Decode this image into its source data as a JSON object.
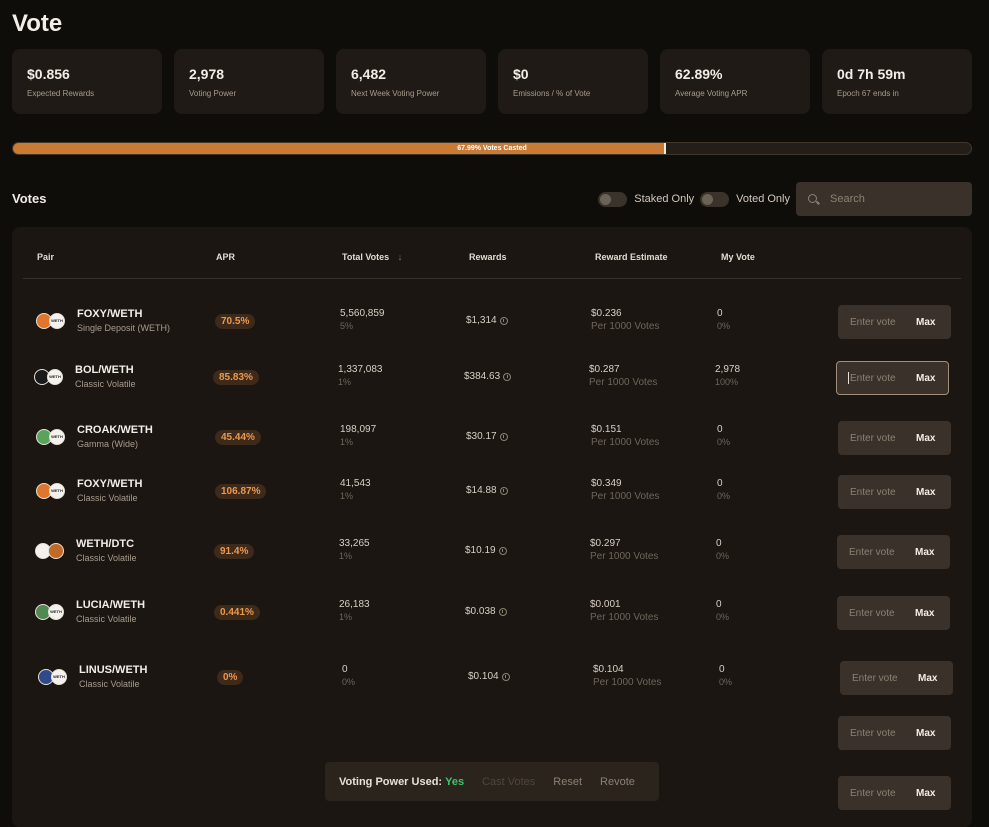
{
  "page": {
    "title": "Vote"
  },
  "stats": [
    {
      "value": "$0.856",
      "label": "Expected Rewards"
    },
    {
      "value": "2,978",
      "label": "Voting Power"
    },
    {
      "value": "6,482",
      "label": "Next Week Voting Power"
    },
    {
      "value": "$0",
      "label": "Emissions / % of Vote"
    },
    {
      "value": "62.89%",
      "label": "Average Voting APR"
    },
    {
      "value": "0d 7h 59m",
      "label": "Epoch 67 ends in"
    }
  ],
  "progress": {
    "label": "67.99% Votes Casted",
    "percent": 67.99
  },
  "votes": {
    "title": "Votes",
    "staked_only_label": "Staked Only",
    "voted_only_label": "Voted Only",
    "search_placeholder": "Search"
  },
  "table": {
    "headers": {
      "pair": "Pair",
      "apr": "APR",
      "total_votes": "Total Votes",
      "rewards": "Rewards",
      "reward_estimate": "Reward Estimate",
      "my_vote": "My Vote"
    },
    "sort_arrow": "↓",
    "input_placeholder": "Enter vote",
    "max_label": "Max",
    "rows": [
      {
        "pair": "FOXY/WETH",
        "type": "Single Deposit (WETH)",
        "apr": "70.5%",
        "total_votes": "5,560,859",
        "total_pct": "5%",
        "rewards": "$1,314",
        "estimate": "$0.236",
        "estimate_sub": "Per 1000 Votes",
        "my_vote": "0",
        "my_pct": "0%",
        "token_a_color": "#e0762b",
        "token_b_label": "WETH"
      },
      {
        "pair": "BOL/WETH",
        "type": "Classic Volatile",
        "apr": "85.83%",
        "total_votes": "1,337,083",
        "total_pct": "1%",
        "rewards": "$384.63",
        "estimate": "$0.287",
        "estimate_sub": "Per 1000 Votes",
        "my_vote": "2,978",
        "my_pct": "100%",
        "token_a_color": "#1a1a1a",
        "token_b_label": "WETH"
      },
      {
        "pair": "CROAK/WETH",
        "type": "Gamma (Wide)",
        "apr": "45.44%",
        "total_votes": "198,097",
        "total_pct": "1%",
        "rewards": "$30.17",
        "estimate": "$0.151",
        "estimate_sub": "Per 1000 Votes",
        "my_vote": "0",
        "my_pct": "0%",
        "token_a_color": "#5aa35a",
        "token_b_label": "WETH"
      },
      {
        "pair": "FOXY/WETH",
        "type": "Classic Volatile",
        "apr": "106.87%",
        "total_votes": "41,543",
        "total_pct": "1%",
        "rewards": "$14.88",
        "estimate": "$0.349",
        "estimate_sub": "Per 1000 Votes",
        "my_vote": "0",
        "my_pct": "0%",
        "token_a_color": "#e0762b",
        "token_b_label": "WETH"
      },
      {
        "pair": "WETH/DTC",
        "type": "Classic Volatile",
        "apr": "91.4%",
        "total_votes": "33,265",
        "total_pct": "1%",
        "rewards": "$10.19",
        "estimate": "$0.297",
        "estimate_sub": "Per 1000 Votes",
        "my_vote": "0",
        "my_pct": "0%",
        "token_a_color": "#f5f2ee",
        "token_b_label": ""
      },
      {
        "pair": "LUCIA/WETH",
        "type": "Classic Volatile",
        "apr": "0.441%",
        "total_votes": "26,183",
        "total_pct": "1%",
        "rewards": "$0.038",
        "estimate": "$0.001",
        "estimate_sub": "Per 1000 Votes",
        "my_vote": "0",
        "my_pct": "0%",
        "token_a_color": "#4f8a55",
        "token_b_label": "WETH"
      },
      {
        "pair": "LINUS/WETH",
        "type": "Classic Volatile",
        "apr": "0%",
        "total_votes": "0",
        "total_pct": "0%",
        "rewards": "$0.104",
        "estimate": "$0.104",
        "estimate_sub": "Per 1000 Votes",
        "my_vote": "0",
        "my_pct": "0%",
        "token_a_color": "#2f4a8a",
        "token_b_label": "WETH"
      }
    ]
  },
  "bottom_bar": {
    "label": "Voting Power Used:",
    "value": "Yes",
    "cast_votes": "Cast Votes",
    "reset": "Reset",
    "revote": "Revote"
  }
}
